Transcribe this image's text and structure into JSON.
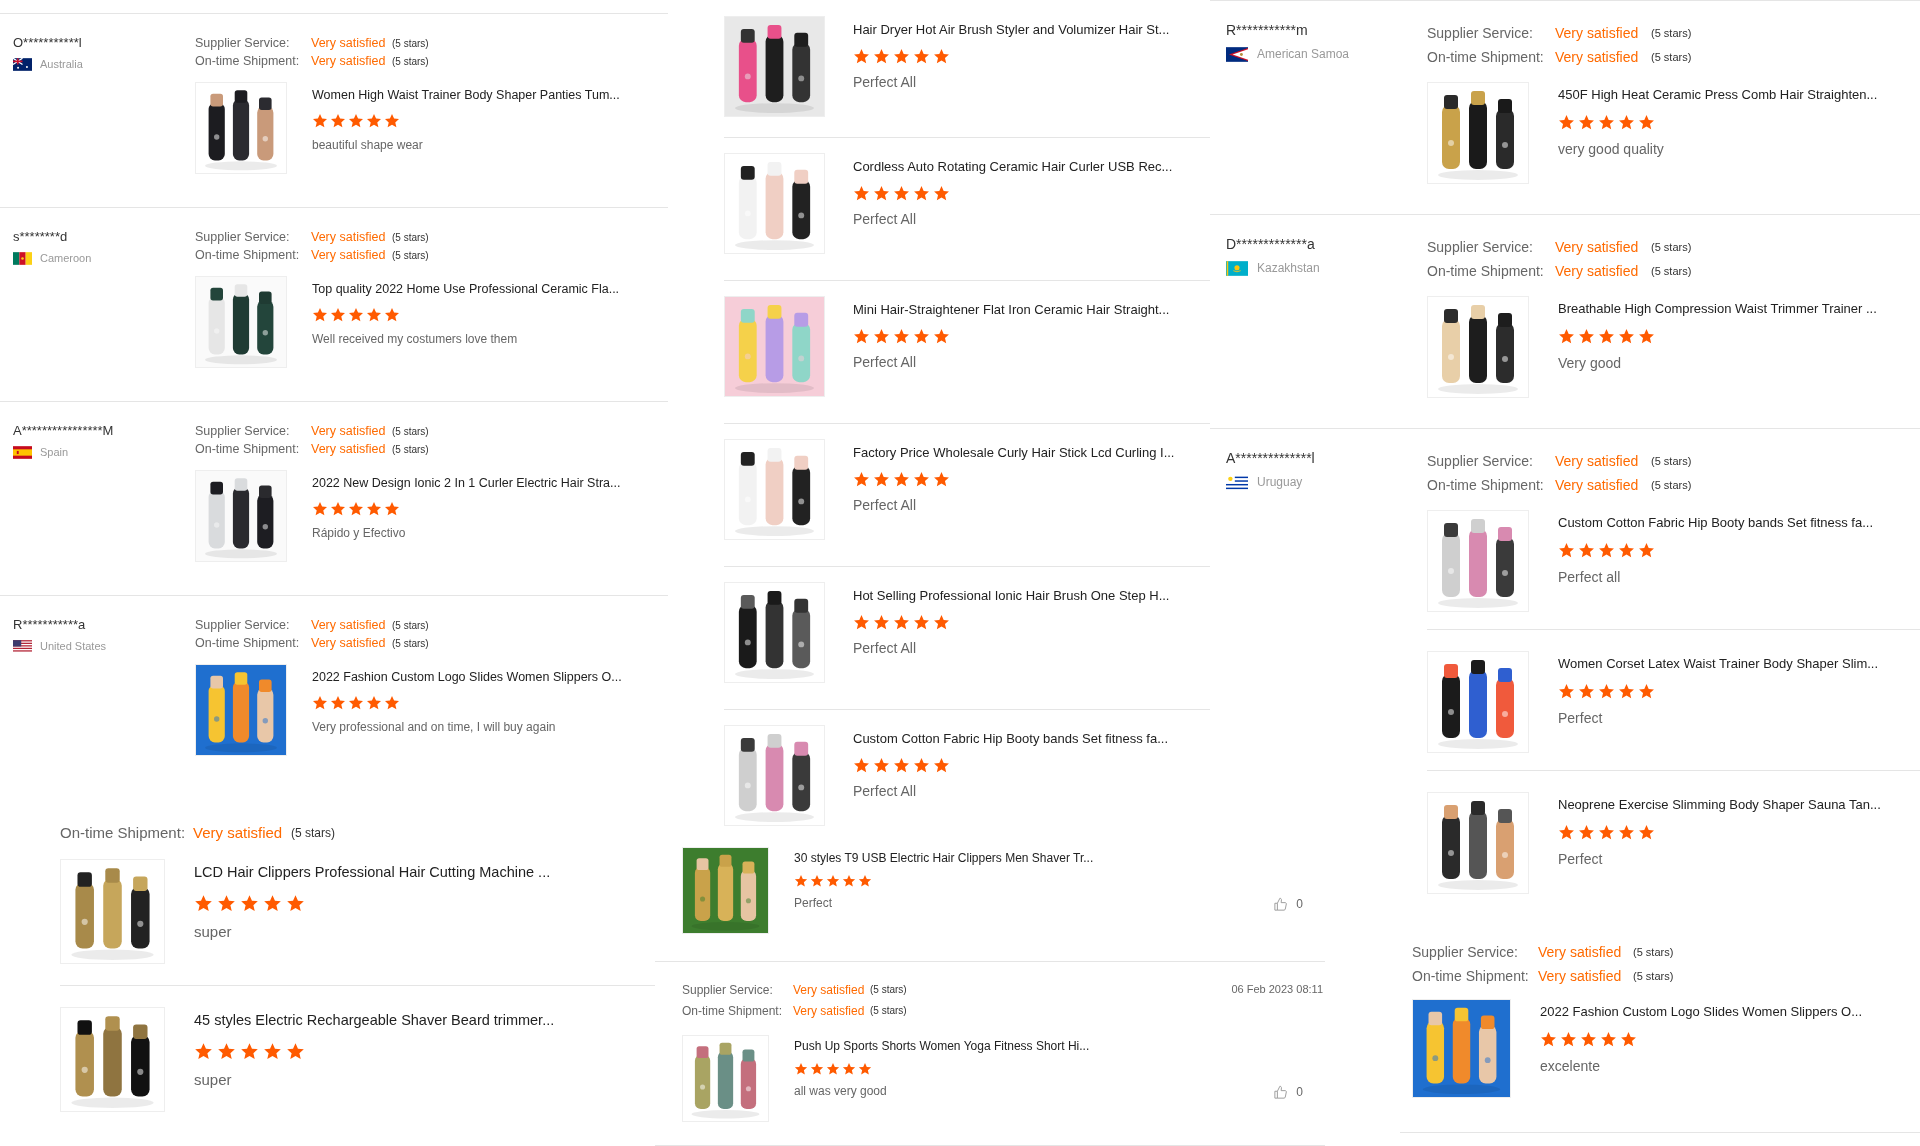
{
  "panels": [
    {
      "entries": [
        {
          "reviewer": "O***********l",
          "country": "Australia",
          "ratings": [
            {
              "label": "Supplier Service:",
              "value": "Very satisfied",
              "note": "(5 stars)"
            },
            {
              "label": "On-time Shipment:",
              "value": "Very satisfied",
              "note": "(5 stars)"
            }
          ],
          "items": [
            {
              "title": "Women High Waist Trainer Body Shaper Panties Tum...",
              "stars": 5,
              "comment": "beautiful shape wear"
            }
          ]
        },
        {
          "reviewer": "s********d",
          "country": "Cameroon",
          "ratings": [
            {
              "label": "Supplier Service:",
              "value": "Very satisfied",
              "note": "(5 stars)"
            },
            {
              "label": "On-time Shipment:",
              "value": "Very satisfied",
              "note": "(5 stars)"
            }
          ],
          "items": [
            {
              "title": "Top quality 2022 Home Use Professional Ceramic Fla...",
              "stars": 5,
              "comment": "Well received my costumers love them"
            }
          ]
        },
        {
          "reviewer": "A****************M",
          "country": "Spain",
          "ratings": [
            {
              "label": "Supplier Service:",
              "value": "Very satisfied",
              "note": "(5 stars)"
            },
            {
              "label": "On-time Shipment:",
              "value": "Very satisfied",
              "note": "(5 stars)"
            }
          ],
          "items": [
            {
              "title": "2022 New Design Ionic 2 In 1 Curler Electric Hair Stra...",
              "stars": 5,
              "comment": "Rápido y Efectivo"
            }
          ]
        },
        {
          "reviewer": "R***********a",
          "country": "United States",
          "ratings": [
            {
              "label": "Supplier Service:",
              "value": "Very satisfied",
              "note": "(5 stars)"
            },
            {
              "label": "On-time Shipment:",
              "value": "Very satisfied",
              "note": "(5 stars)"
            }
          ],
          "items": [
            {
              "title": "2022 Fashion Custom Logo Slides Women Slippers O...",
              "stars": 5,
              "comment": "Very professional and on time, I will buy again"
            }
          ]
        }
      ]
    },
    {
      "entries": [
        {
          "ratings": [
            {
              "label": "On-time Shipment:",
              "value": "Very satisfied",
              "note": "(5 stars)"
            }
          ],
          "items": [
            {
              "title": "LCD Hair Clippers Professional Hair Cutting Machine ...",
              "stars": 5,
              "comment": "super"
            },
            {
              "title": "45 styles Electric Rechargeable Shaver Beard trimmer...",
              "stars": 5,
              "comment": "super"
            }
          ]
        }
      ]
    },
    {
      "entries": [
        {
          "items": [
            {
              "title": "Hair Dryer Hot Air Brush Styler and Volumizer Hair St...",
              "stars": 5,
              "comment": "Perfect All"
            },
            {
              "title": "Cordless Auto Rotating Ceramic Hair Curler USB Rec...",
              "stars": 5,
              "comment": "Perfect All"
            },
            {
              "title": "Mini Hair-Straightener Flat Iron Ceramic Hair Straight...",
              "stars": 5,
              "comment": "Perfect All"
            },
            {
              "title": "Factory Price Wholesale Curly Hair Stick Lcd Curling I...",
              "stars": 5,
              "comment": "Perfect All"
            },
            {
              "title": "Hot Selling Professional Ionic Hair Brush One Step H...",
              "stars": 5,
              "comment": "Perfect All"
            },
            {
              "title": "Custom Cotton Fabric Hip Booty bands Set fitness fa...",
              "stars": 5,
              "comment": "Perfect All"
            }
          ]
        }
      ]
    },
    {
      "entries": [
        {
          "items": [
            {
              "title": "30 styles T9 USB Electric Hair Clippers Men Shaver Tr...",
              "stars": 5,
              "comment": "Perfect",
              "likes": "0"
            }
          ]
        },
        {
          "ratings": [
            {
              "label": "Supplier Service:",
              "value": "Very satisfied",
              "note": "(5 stars)"
            },
            {
              "label": "On-time Shipment:",
              "value": "Very satisfied",
              "note": "(5 stars)"
            }
          ],
          "date": "06 Feb 2023 08:11",
          "items": [
            {
              "title": "Push Up Sports Shorts Women Yoga Fitness Short Hi...",
              "stars": 5,
              "comment": "all was very good",
              "likes": "0"
            }
          ]
        }
      ]
    },
    {
      "entries": [
        {
          "reviewer": "R***********m",
          "country": "American Samoa",
          "ratings": [
            {
              "label": "Supplier Service:",
              "value": "Very satisfied",
              "note": "(5 stars)"
            },
            {
              "label": "On-time Shipment:",
              "value": "Very satisfied",
              "note": "(5 stars)"
            }
          ],
          "items": [
            {
              "title": "450F High Heat Ceramic Press Comb Hair Straighten...",
              "stars": 5,
              "comment": "very good quality"
            }
          ]
        },
        {
          "reviewer": "D*************a",
          "country": "Kazakhstan",
          "ratings": [
            {
              "label": "Supplier Service:",
              "value": "Very satisfied",
              "note": "(5 stars)"
            },
            {
              "label": "On-time Shipment:",
              "value": "Very satisfied",
              "note": "(5 stars)"
            }
          ],
          "items": [
            {
              "title": "Breathable High Compression Waist Trimmer Trainer ...",
              "stars": 5,
              "comment": "Very good"
            }
          ]
        },
        {
          "reviewer": "A**************l",
          "country": "Uruguay",
          "ratings": [
            {
              "label": "Supplier Service:",
              "value": "Very satisfied",
              "note": "(5 stars)"
            },
            {
              "label": "On-time Shipment:",
              "value": "Very satisfied",
              "note": "(5 stars)"
            }
          ],
          "items": [
            {
              "title": "Custom Cotton Fabric Hip Booty bands Set fitness fa...",
              "stars": 5,
              "comment": "Perfect all"
            },
            {
              "title": "Women Corset Latex Waist Trainer Body Shaper Slim...",
              "stars": 5,
              "comment": "Perfect"
            },
            {
              "title": "Neoprene Exercise Slimming Body Shaper Sauna Tan...",
              "stars": 5,
              "comment": "Perfect"
            }
          ]
        }
      ]
    },
    {
      "entries": [
        {
          "ratings": [
            {
              "label": "Supplier Service:",
              "value": "Very satisfied",
              "note": "(5 stars)"
            },
            {
              "label": "On-time Shipment:",
              "value": "Very satisfied",
              "note": "(5 stars)"
            }
          ],
          "items": [
            {
              "title": "2022 Fashion Custom Logo Slides Women Slippers O...",
              "stars": 5,
              "comment": "excelente"
            }
          ]
        }
      ]
    }
  ]
}
